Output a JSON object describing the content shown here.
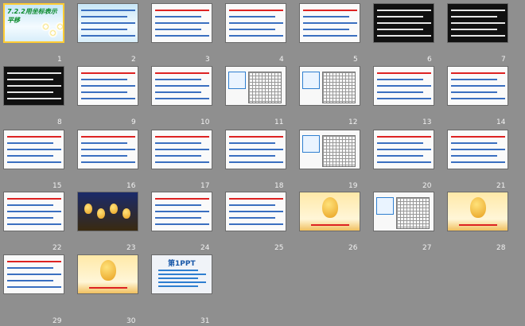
{
  "slides": [
    {
      "num": "1",
      "theme": "t-blue",
      "selected": true
    },
    {
      "num": "2",
      "theme": "t-blue"
    },
    {
      "num": "3",
      "theme": "t-white"
    },
    {
      "num": "4",
      "theme": "t-white"
    },
    {
      "num": "5",
      "theme": "t-white"
    },
    {
      "num": "6",
      "theme": "t-dark"
    },
    {
      "num": "7",
      "theme": "t-dark"
    },
    {
      "num": "8",
      "theme": "t-dark"
    },
    {
      "num": "9",
      "theme": "t-white"
    },
    {
      "num": "10",
      "theme": "t-white"
    },
    {
      "num": "11",
      "theme": "t-grid"
    },
    {
      "num": "12",
      "theme": "t-grid"
    },
    {
      "num": "13",
      "theme": "t-white"
    },
    {
      "num": "14",
      "theme": "t-white"
    },
    {
      "num": "15",
      "theme": "t-white"
    },
    {
      "num": "16",
      "theme": "t-white"
    },
    {
      "num": "17",
      "theme": "t-white"
    },
    {
      "num": "18",
      "theme": "t-white"
    },
    {
      "num": "19",
      "theme": "t-grid"
    },
    {
      "num": "20",
      "theme": "t-white"
    },
    {
      "num": "21",
      "theme": "t-white"
    },
    {
      "num": "22",
      "theme": "t-white"
    },
    {
      "num": "23",
      "theme": "t-stage"
    },
    {
      "num": "24",
      "theme": "t-white"
    },
    {
      "num": "25",
      "theme": "t-white"
    },
    {
      "num": "26",
      "theme": "t-gold"
    },
    {
      "num": "27",
      "theme": "t-grid"
    },
    {
      "num": "28",
      "theme": "t-gold"
    },
    {
      "num": "29",
      "theme": "t-white"
    },
    {
      "num": "30",
      "theme": "t-gold"
    },
    {
      "num": "31",
      "theme": "t-ppt"
    }
  ],
  "slide1": {
    "title": "7.2.2用坐标表示平移"
  },
  "slide31": {
    "logo": "第1PPT"
  }
}
